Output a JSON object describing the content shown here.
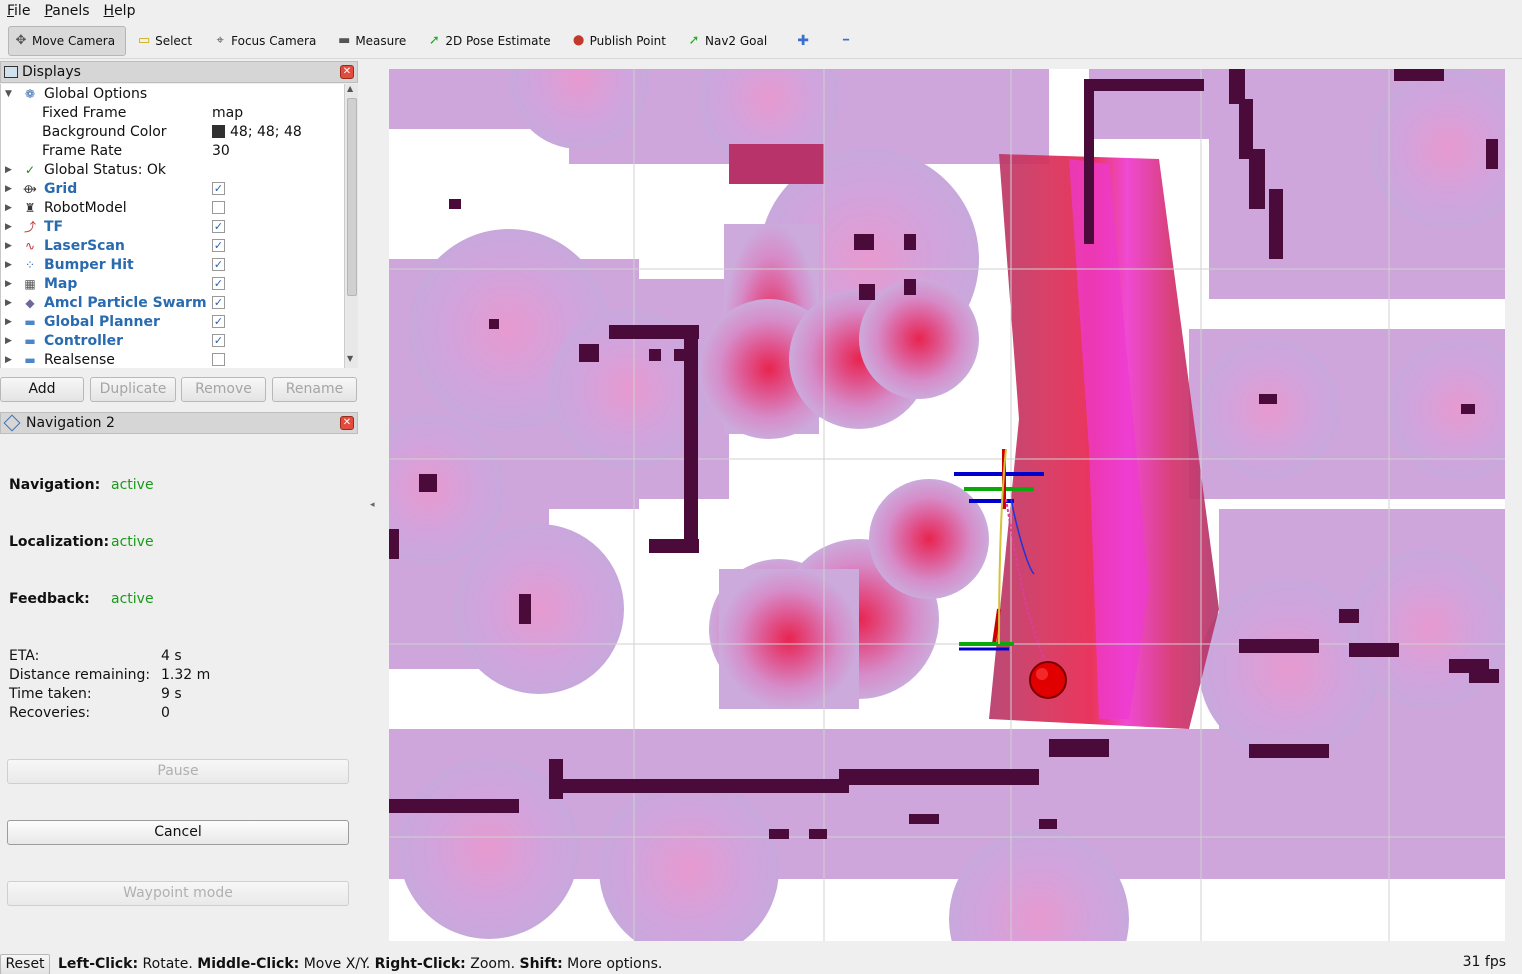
{
  "menu": {
    "items": [
      {
        "label": "File",
        "key": "F",
        "rest": "ile"
      },
      {
        "label": "Panels",
        "key": "P",
        "rest": "anels"
      },
      {
        "label": "Help",
        "key": "H",
        "rest": "elp"
      }
    ]
  },
  "toolbar": {
    "tools": [
      {
        "label": "Move Camera",
        "icon": "move-camera-icon",
        "active": true
      },
      {
        "label": "Select",
        "icon": "select-icon"
      },
      {
        "label": "Focus Camera",
        "icon": "focus-camera-icon"
      },
      {
        "label": "Measure",
        "icon": "measure-icon"
      },
      {
        "label": "2D Pose Estimate",
        "icon": "pose-estimate-icon"
      },
      {
        "label": "Publish Point",
        "icon": "publish-point-icon"
      },
      {
        "label": "Nav2 Goal",
        "icon": "nav2-goal-icon"
      }
    ],
    "add_icon": "plus-icon",
    "remove_icon": "minus-icon"
  },
  "displays": {
    "title": "Displays",
    "rows": [
      {
        "kind": "group",
        "name": "Global Options",
        "icon": "gear-icon",
        "expanded": true
      },
      {
        "kind": "prop",
        "name": "Fixed Frame",
        "value": "map"
      },
      {
        "kind": "prop",
        "name": "Background Color",
        "value": "48; 48; 48",
        "color": "#303030"
      },
      {
        "kind": "prop",
        "name": "Frame Rate",
        "value": "30"
      },
      {
        "kind": "status",
        "name": "Global Status: Ok",
        "icon": "checkmark-icon"
      },
      {
        "kind": "display",
        "name": "Grid",
        "icon": "grid-icon",
        "checked": true
      },
      {
        "kind": "display",
        "name": "RobotModel",
        "icon": "robot-model-icon",
        "checked": false,
        "plain": true
      },
      {
        "kind": "display",
        "name": "TF",
        "icon": "tf-axes-icon",
        "checked": true
      },
      {
        "kind": "display",
        "name": "LaserScan",
        "icon": "laser-scan-icon",
        "checked": true
      },
      {
        "kind": "display",
        "name": "Bumper Hit",
        "icon": "bumper-hit-icon",
        "checked": true
      },
      {
        "kind": "display",
        "name": "Map",
        "icon": "map-icon",
        "checked": true
      },
      {
        "kind": "display",
        "name": "Amcl Particle Swarm",
        "icon": "particle-swarm-icon",
        "checked": true
      },
      {
        "kind": "display",
        "name": "Global Planner",
        "icon": "folder-icon",
        "checked": true
      },
      {
        "kind": "display",
        "name": "Controller",
        "icon": "folder-icon",
        "checked": true
      },
      {
        "kind": "display",
        "name": "Realsense",
        "icon": "folder-icon",
        "checked": false,
        "plain": true
      }
    ],
    "buttons": {
      "add": "Add",
      "duplicate": "Duplicate",
      "remove": "Remove",
      "rename": "Rename"
    }
  },
  "navigation": {
    "title": "Navigation 2",
    "navigation_label": "Navigation:",
    "navigation_status": "active",
    "localization_label": "Localization:",
    "localization_status": "active",
    "feedback_label": "Feedback:",
    "feedback_status": "active",
    "eta_label": "ETA:",
    "eta_value": "4 s",
    "distance_label": "Distance remaining:",
    "distance_value": "1.32 m",
    "time_label": "Time taken:",
    "time_value": "9 s",
    "recoveries_label": "Recoveries:",
    "recoveries_value": "0",
    "pause_button": "Pause",
    "cancel_button": "Cancel",
    "waypoint_button": "Waypoint mode"
  },
  "statusbar": {
    "reset": "Reset",
    "hint_parts": [
      {
        "b": "Left-Click:",
        "t": " Rotate. "
      },
      {
        "b": "Middle-Click:",
        "t": " Move X/Y. "
      },
      {
        "b": "Right-Click:",
        "t": " Zoom. "
      },
      {
        "b": "Shift:",
        "t": " More options."
      }
    ],
    "fps": "31 fps"
  },
  "colors": {
    "status_active": "#1a9a1a",
    "display_name_blue": "#2a6bb0",
    "costmap_light": "#c9a3d6",
    "costmap_mid": "#e586c4",
    "costmap_hot": "#e8244f",
    "obstacle": "#4a0a3a",
    "goal_marker": "#e00000"
  }
}
